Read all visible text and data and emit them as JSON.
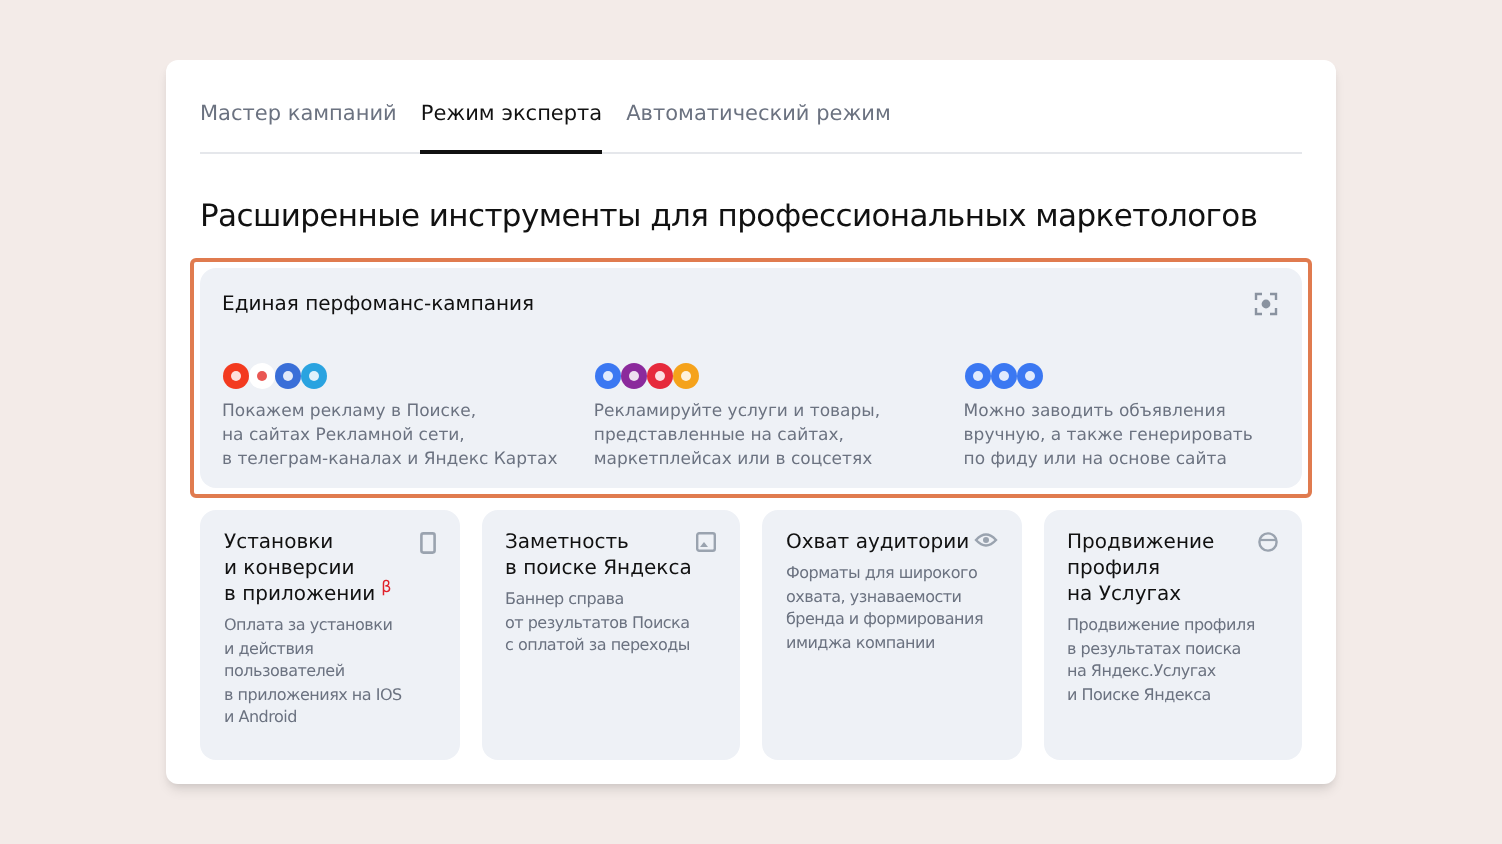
{
  "tabs": [
    {
      "label": "Мастер кампаний",
      "selected": false
    },
    {
      "label": "Режим эксперта",
      "selected": true
    },
    {
      "label": "Автоматический режим",
      "selected": false
    }
  ],
  "heading": "Расширенные инструменты для профессиональных маркетологов",
  "main_card": {
    "title": "Единая перфоманс-кампания",
    "highlighted": true,
    "columns": [
      {
        "icons": [
          {
            "color": "#f33a1f"
          },
          {
            "color": "#ffffff"
          },
          {
            "color": "#3a6fd8"
          },
          {
            "color": "#2aa3e0"
          }
        ],
        "text": "Покажем рекламу в Поиске,\nна сайтах Рекламной сети,\nв телеграм-каналах и Яндекс Картах"
      },
      {
        "icons": [
          {
            "color": "#3b78f2"
          },
          {
            "color": "#8b2a9c"
          },
          {
            "color": "#e62a3c"
          },
          {
            "color": "#f5a21b"
          }
        ],
        "text": "Рекламируйте услуги и товары,\nпредставленные на сайтах,\nмаркетплейсах или в соцсетях"
      },
      {
        "icons": [
          {
            "color": "#3b78f2"
          },
          {
            "color": "#3b78f2"
          },
          {
            "color": "#3b78f2"
          }
        ],
        "text": "Можно заводить объявления\nвручную, а также генерировать\nпо фиду или на основе сайта"
      }
    ]
  },
  "cards": [
    {
      "kind": "phone",
      "title": "Установки\nи конверсии\nв приложении",
      "badge": "β",
      "text": "Оплата за установки\nи действия\nпользователей\nв приложениях на IOS\nи Android"
    },
    {
      "kind": "banner",
      "title": "Заметность\nв поиске Яндекса",
      "text": "Баннер справа\nот результатов Поиска\nс оплатой за переходы"
    },
    {
      "kind": "eye",
      "title": "Охват аудитории",
      "text": "Форматы для широкого\nохвата, узнаваемости\nбренда и формирования\nимиджа компании"
    },
    {
      "kind": "globe",
      "title": "Продвижение\nпрофиля\nна Услугах",
      "text": "Продвижение профиля\nв результатах поиска\nна Яндекс.Услугах\nи Поиске Яндекса"
    }
  ]
}
